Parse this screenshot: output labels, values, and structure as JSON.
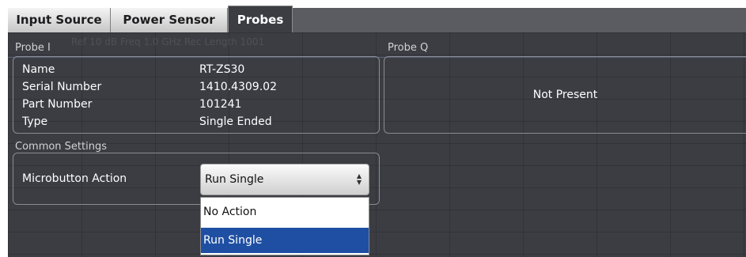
{
  "tabs": [
    {
      "label": "Input Source",
      "active": false
    },
    {
      "label": "Power Sensor",
      "active": false
    },
    {
      "label": "Probes",
      "active": true
    }
  ],
  "background_ghost_text": "Ref 10 dB    Freq 1.0 GHz    Rec Length    1001",
  "probe_i": {
    "title": "Probe I",
    "rows": [
      {
        "label": "Name",
        "value": "RT-ZS30"
      },
      {
        "label": "Serial Number",
        "value": "1410.4309.02"
      },
      {
        "label": "Part Number",
        "value": "101241"
      },
      {
        "label": "Type",
        "value": "Single Ended"
      }
    ]
  },
  "probe_q": {
    "title": "Probe Q",
    "status": "Not Present"
  },
  "common_settings": {
    "title": "Common Settings",
    "microbutton_label": "Microbutton Action",
    "selected": "Run Single",
    "options": [
      "No Action",
      "Run Single"
    ]
  },
  "colors": {
    "panel_bg": "#3b3d43",
    "selection_blue": "#1f4fa3",
    "tab_bar": "#5a5c61"
  }
}
